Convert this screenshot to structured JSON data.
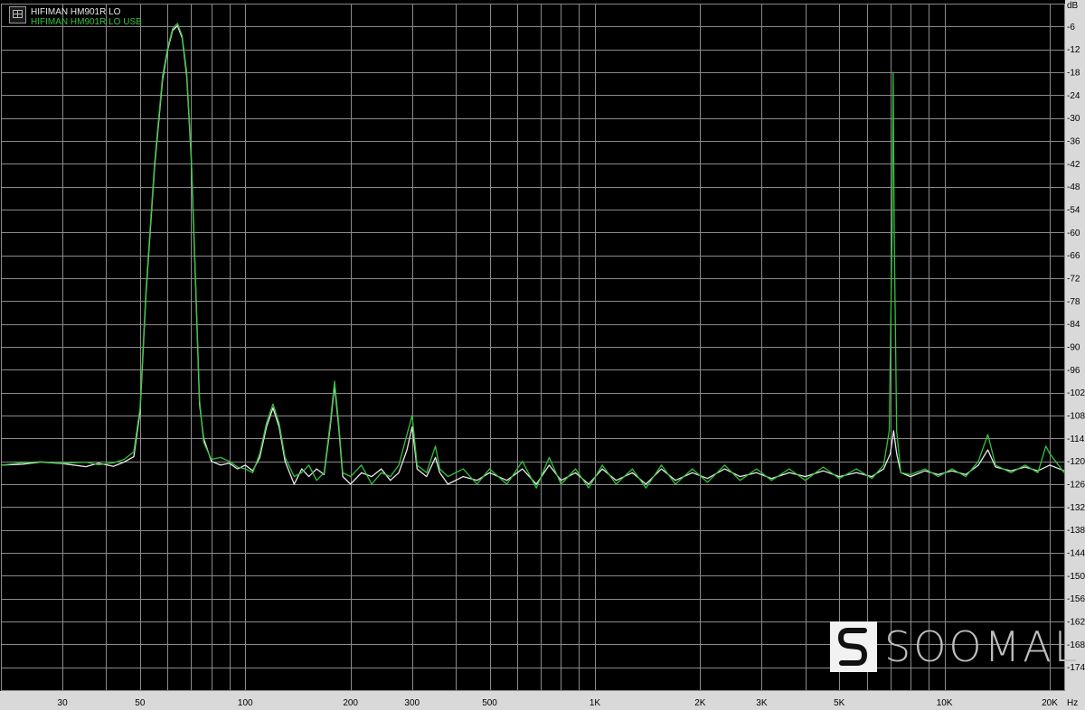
{
  "chart_data": {
    "type": "line",
    "title": "",
    "xlabel": "Hz",
    "ylabel": "dB",
    "x_scale": "log",
    "xlim": [
      20,
      22000
    ],
    "ylim": [
      -180,
      0
    ],
    "x_ticks": [
      {
        "value": 30,
        "label": "30"
      },
      {
        "value": 50,
        "label": "50"
      },
      {
        "value": 100,
        "label": "100"
      },
      {
        "value": 200,
        "label": "200"
      },
      {
        "value": 300,
        "label": "300"
      },
      {
        "value": 500,
        "label": "500"
      },
      {
        "value": 1000,
        "label": "1K"
      },
      {
        "value": 2000,
        "label": "2K"
      },
      {
        "value": 3000,
        "label": "3K"
      },
      {
        "value": 5000,
        "label": "5K"
      },
      {
        "value": 10000,
        "label": "10K"
      },
      {
        "value": 20000,
        "label": "20K"
      }
    ],
    "y_ticks": [
      -6,
      -12,
      -18,
      -24,
      -30,
      -36,
      -42,
      -48,
      -54,
      -60,
      -66,
      -72,
      -78,
      -84,
      -90,
      -96,
      -102,
      -108,
      -114,
      -120,
      -126,
      -132,
      -138,
      -144,
      -150,
      -156,
      -162,
      -168,
      -174
    ],
    "grid": true,
    "legend_position": "top-left",
    "series": [
      {
        "name": "HIFIMAN HM901R LO",
        "color": "#e8e8e8",
        "points": [
          [
            20,
            -121
          ],
          [
            23,
            -120.8
          ],
          [
            26,
            -120.2
          ],
          [
            30,
            -120.6
          ],
          [
            35,
            -121.4
          ],
          [
            38,
            -120.5
          ],
          [
            42,
            -121.3
          ],
          [
            45,
            -120.2
          ],
          [
            48,
            -118.8
          ],
          [
            50,
            -107
          ],
          [
            52,
            -76
          ],
          [
            55,
            -43
          ],
          [
            58,
            -20
          ],
          [
            60,
            -12
          ],
          [
            62,
            -7
          ],
          [
            64,
            -5.8
          ],
          [
            66,
            -9
          ],
          [
            68,
            -19
          ],
          [
            70,
            -40
          ],
          [
            72,
            -72
          ],
          [
            74,
            -105
          ],
          [
            76,
            -114
          ],
          [
            80,
            -120
          ],
          [
            85,
            -121
          ],
          [
            90,
            -120.5
          ],
          [
            95,
            -122
          ],
          [
            100,
            -121
          ],
          [
            105,
            -122.5
          ],
          [
            110,
            -119
          ],
          [
            115,
            -111
          ],
          [
            120,
            -106
          ],
          [
            125,
            -111
          ],
          [
            130,
            -120
          ],
          [
            138,
            -126
          ],
          [
            145,
            -122
          ],
          [
            152,
            -124
          ],
          [
            160,
            -122
          ],
          [
            168,
            -123.5
          ],
          [
            175,
            -111
          ],
          [
            180,
            -100
          ],
          [
            185,
            -111
          ],
          [
            190,
            -124
          ],
          [
            200,
            -126
          ],
          [
            215,
            -123
          ],
          [
            230,
            -124
          ],
          [
            245,
            -122
          ],
          [
            260,
            -125
          ],
          [
            275,
            -123
          ],
          [
            290,
            -117
          ],
          [
            300,
            -111
          ],
          [
            310,
            -122
          ],
          [
            330,
            -124
          ],
          [
            350,
            -119
          ],
          [
            360,
            -123
          ],
          [
            380,
            -126
          ],
          [
            420,
            -124
          ],
          [
            460,
            -125
          ],
          [
            500,
            -123
          ],
          [
            560,
            -125
          ],
          [
            620,
            -122
          ],
          [
            680,
            -126
          ],
          [
            740,
            -121
          ],
          [
            800,
            -125
          ],
          [
            880,
            -123
          ],
          [
            960,
            -126
          ],
          [
            1050,
            -122
          ],
          [
            1150,
            -125
          ],
          [
            1280,
            -123
          ],
          [
            1400,
            -126
          ],
          [
            1550,
            -122
          ],
          [
            1700,
            -125
          ],
          [
            1900,
            -123
          ],
          [
            2100,
            -124.5
          ],
          [
            2350,
            -122
          ],
          [
            2600,
            -124
          ],
          [
            2900,
            -123
          ],
          [
            3200,
            -124.5
          ],
          [
            3600,
            -123
          ],
          [
            4000,
            -124
          ],
          [
            4500,
            -122.5
          ],
          [
            5000,
            -124
          ],
          [
            5600,
            -123
          ],
          [
            6200,
            -124
          ],
          [
            6700,
            -122
          ],
          [
            7000,
            -118
          ],
          [
            7150,
            -112
          ],
          [
            7300,
            -118
          ],
          [
            7500,
            -123
          ],
          [
            8000,
            -124
          ],
          [
            8800,
            -122.5
          ],
          [
            9600,
            -123.5
          ],
          [
            10500,
            -122.5
          ],
          [
            11500,
            -123.5
          ],
          [
            12500,
            -121
          ],
          [
            13300,
            -117
          ],
          [
            14000,
            -121.5
          ],
          [
            15500,
            -122.5
          ],
          [
            17000,
            -121.5
          ],
          [
            18500,
            -122.5
          ],
          [
            20000,
            -121
          ],
          [
            22000,
            -122.5
          ]
        ]
      },
      {
        "name": "HIFIMAN HM901R LO USB",
        "color": "#33c23a",
        "points": [
          [
            20,
            -121
          ],
          [
            23,
            -120.4
          ],
          [
            26,
            -120.1
          ],
          [
            30,
            -120.5
          ],
          [
            35,
            -120.2
          ],
          [
            38,
            -120.9
          ],
          [
            42,
            -120.4
          ],
          [
            45,
            -119.5
          ],
          [
            48,
            -117.5
          ],
          [
            50,
            -106
          ],
          [
            52,
            -75
          ],
          [
            55,
            -42
          ],
          [
            58,
            -19
          ],
          [
            60,
            -11.5
          ],
          [
            62,
            -6.5
          ],
          [
            64,
            -5.2
          ],
          [
            66,
            -8.5
          ],
          [
            68,
            -18
          ],
          [
            70,
            -39
          ],
          [
            72,
            -71
          ],
          [
            74,
            -104
          ],
          [
            76,
            -115
          ],
          [
            80,
            -119.5
          ],
          [
            85,
            -119
          ],
          [
            90,
            -120
          ],
          [
            95,
            -121.5
          ],
          [
            100,
            -122
          ],
          [
            105,
            -123
          ],
          [
            110,
            -118
          ],
          [
            115,
            -110
          ],
          [
            120,
            -105
          ],
          [
            125,
            -110
          ],
          [
            130,
            -119
          ],
          [
            138,
            -124
          ],
          [
            145,
            -123
          ],
          [
            152,
            -121
          ],
          [
            160,
            -125
          ],
          [
            168,
            -123
          ],
          [
            175,
            -110
          ],
          [
            180,
            -99
          ],
          [
            185,
            -110
          ],
          [
            190,
            -123
          ],
          [
            200,
            -124
          ],
          [
            215,
            -121
          ],
          [
            230,
            -126
          ],
          [
            245,
            -123
          ],
          [
            260,
            -124
          ],
          [
            275,
            -121
          ],
          [
            290,
            -113
          ],
          [
            300,
            -108
          ],
          [
            310,
            -121
          ],
          [
            330,
            -123
          ],
          [
            350,
            -116
          ],
          [
            360,
            -122
          ],
          [
            380,
            -124
          ],
          [
            420,
            -122
          ],
          [
            460,
            -126
          ],
          [
            500,
            -122
          ],
          [
            560,
            -126
          ],
          [
            620,
            -120
          ],
          [
            680,
            -127
          ],
          [
            740,
            -119
          ],
          [
            800,
            -126
          ],
          [
            880,
            -122
          ],
          [
            960,
            -127
          ],
          [
            1050,
            -121
          ],
          [
            1150,
            -126
          ],
          [
            1280,
            -122
          ],
          [
            1400,
            -127
          ],
          [
            1550,
            -121
          ],
          [
            1700,
            -126
          ],
          [
            1900,
            -122
          ],
          [
            2100,
            -125.5
          ],
          [
            2350,
            -121
          ],
          [
            2600,
            -125
          ],
          [
            2900,
            -122
          ],
          [
            3200,
            -125
          ],
          [
            3600,
            -122
          ],
          [
            4000,
            -125
          ],
          [
            4500,
            -121.5
          ],
          [
            5000,
            -124.5
          ],
          [
            5600,
            -122
          ],
          [
            6200,
            -124.5
          ],
          [
            6700,
            -121
          ],
          [
            6950,
            -112
          ],
          [
            7080,
            -60
          ],
          [
            7130,
            -18
          ],
          [
            7180,
            -60
          ],
          [
            7300,
            -112
          ],
          [
            7500,
            -123
          ],
          [
            8000,
            -123.5
          ],
          [
            8800,
            -122
          ],
          [
            9600,
            -124
          ],
          [
            10500,
            -122
          ],
          [
            11500,
            -124
          ],
          [
            12500,
            -120
          ],
          [
            13300,
            -113
          ],
          [
            14000,
            -121
          ],
          [
            15500,
            -123
          ],
          [
            17000,
            -121
          ],
          [
            18500,
            -123
          ],
          [
            19500,
            -116
          ],
          [
            20000,
            -118
          ],
          [
            22000,
            -123
          ]
        ]
      }
    ]
  },
  "legend_icon": "legend-grid-icon",
  "watermark": {
    "text": "SOOMAL",
    "logo_icon": "soomal-logo-icon"
  }
}
